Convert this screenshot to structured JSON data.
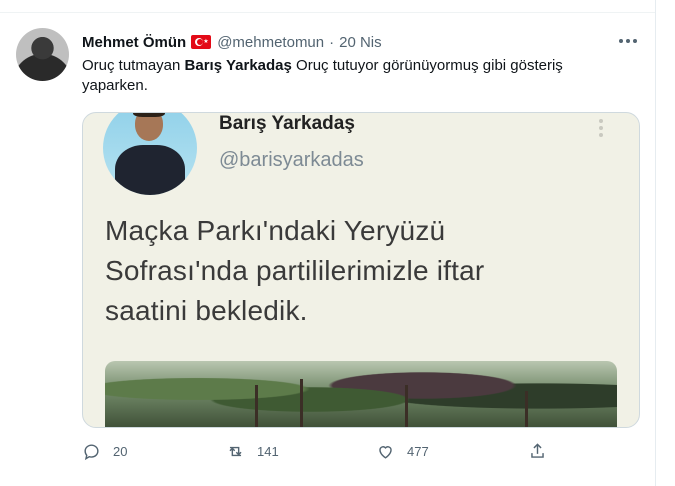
{
  "tweet": {
    "author_name": "Mehmet Ömün",
    "author_handle": "@mehmetomun",
    "separator": "·",
    "date": "20 Nis",
    "flag_icon": "turkey-flag-icon",
    "text_before": "Oruç tutmayan ",
    "text_bold": "Barış Yarkadaş",
    "text_after": " Oruç tutuyor görünüyormuş gibi gösteriş yaparken."
  },
  "embedded_image": {
    "name": "Barış Yarkadaş",
    "handle": "@barisyarkadas",
    "text": "Maçka Parkı'ndaki Yeryüzü Sofrası'nda partililerimizle iftar saatini bekledik."
  },
  "actions": {
    "reply_count": "20",
    "retweet_count": "141",
    "like_count": "477",
    "icons": [
      "reply-icon",
      "retweet-icon",
      "like-icon",
      "share-icon"
    ]
  },
  "colors": {
    "muted": "#536471",
    "border": "#cfd9de",
    "image_background": "#f1f1e6"
  }
}
